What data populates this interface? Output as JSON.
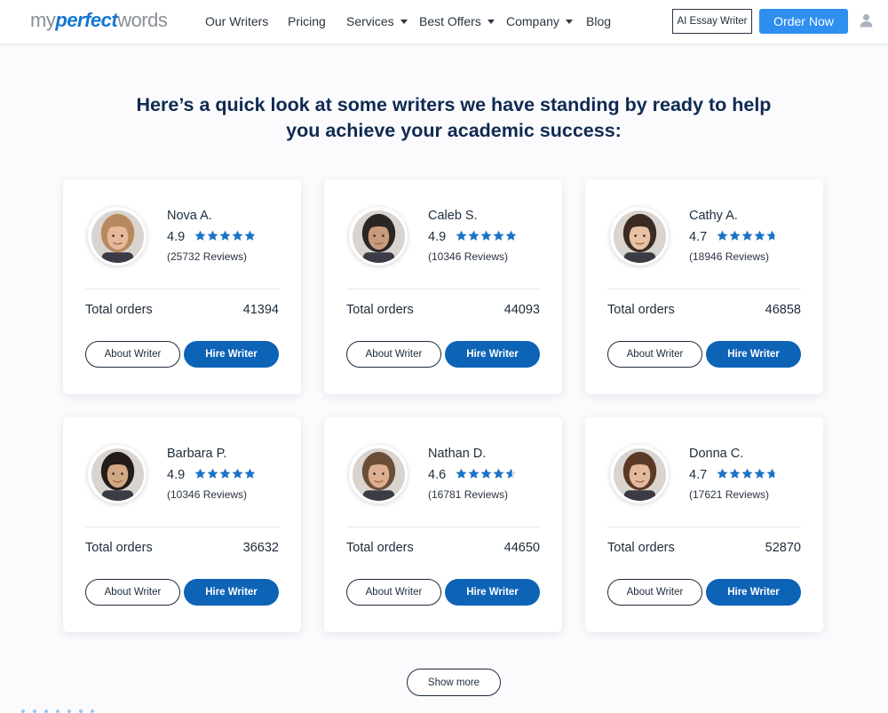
{
  "nav": {
    "logo": {
      "part1": "my",
      "part2": "perfect",
      "part3": "words"
    },
    "links": [
      {
        "label": "Our Writers",
        "dropdown": false
      },
      {
        "label": "Pricing",
        "dropdown": false
      },
      {
        "label": "Services",
        "dropdown": true
      },
      {
        "label": "Best Offers",
        "dropdown": true
      },
      {
        "label": "Company",
        "dropdown": true
      },
      {
        "label": "Blog",
        "dropdown": false
      }
    ],
    "ai_button": "AI Essay Writer",
    "order_button": "Order Now",
    "user_icon": "user-icon"
  },
  "heading": {
    "line1": "Here’s a quick look at some writers we have standing by ready to help",
    "line2": "you achieve your academic success:"
  },
  "writers": [
    {
      "name": "Nova A.",
      "rating": "4.9",
      "stars": 4.9,
      "reviews": "(25732 Reviews)",
      "orders_label": "Total orders",
      "orders": "41394",
      "about": "About Writer",
      "hire": "Hire Writer",
      "skin": "#e5b999",
      "hair": "#b8895c"
    },
    {
      "name": "Caleb S.",
      "rating": "4.9",
      "stars": 4.9,
      "reviews": "(10346 Reviews)",
      "orders_label": "Total orders",
      "orders": "44093",
      "about": "About Writer",
      "hire": "Hire Writer",
      "skin": "#c89b7b",
      "hair": "#2b2623"
    },
    {
      "name": "Cathy A.",
      "rating": "4.7",
      "stars": 4.7,
      "reviews": "(18946 Reviews)",
      "orders_label": "Total orders",
      "orders": "46858",
      "about": "About Writer",
      "hire": "Hire Writer",
      "skin": "#e8c2a4",
      "hair": "#3a2a22"
    },
    {
      "name": "Barbara P.",
      "rating": "4.9",
      "stars": 4.9,
      "reviews": "(10346 Reviews)",
      "orders_label": "Total orders",
      "orders": "36632",
      "about": "About Writer",
      "hire": "Hire Writer",
      "skin": "#d2a884",
      "hair": "#241c18"
    },
    {
      "name": "Nathan D.",
      "rating": "4.6",
      "stars": 4.6,
      "reviews": "(16781 Reviews)",
      "orders_label": "Total orders",
      "orders": "44650",
      "about": "About Writer",
      "hire": "Hire Writer",
      "skin": "#dcaf90",
      "hair": "#6a4e38"
    },
    {
      "name": "Donna C.",
      "rating": "4.7",
      "stars": 4.7,
      "reviews": "(17621 Reviews)",
      "orders_label": "Total orders",
      "orders": "52870",
      "about": "About Writer",
      "hire": "Hire Writer",
      "skin": "#e3bb9c",
      "hair": "#5a3a26"
    }
  ],
  "show_more": "Show more",
  "colors": {
    "brand_blue": "#0d63b6",
    "accent_blue": "#2e8ff0",
    "star_blue": "#1a73c8",
    "heading_navy": "#0f2a52"
  }
}
